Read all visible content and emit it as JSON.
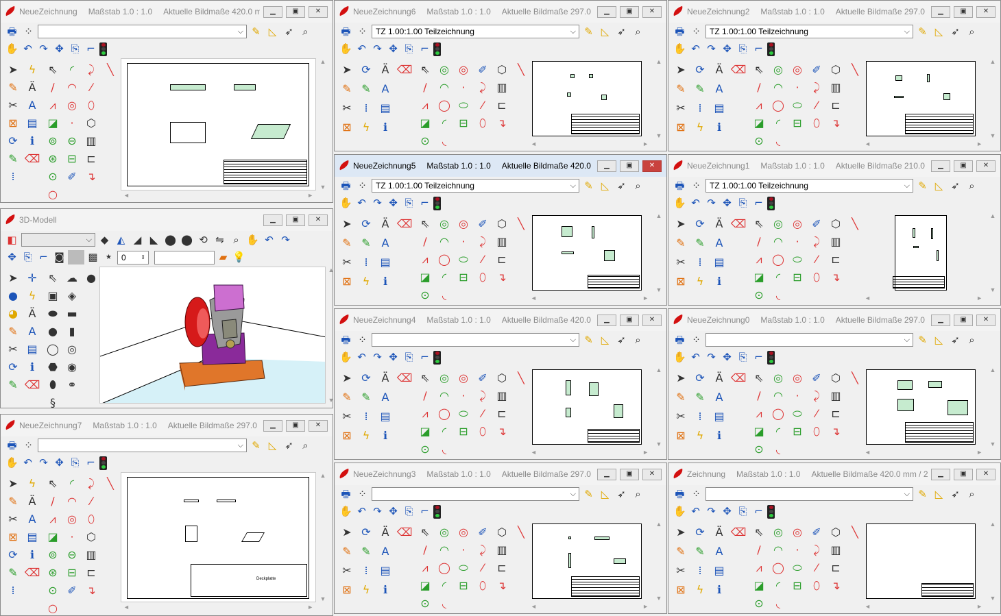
{
  "colors": {
    "accent": "#d31010",
    "part": "#2bb54a",
    "close_active": "#c9423e"
  },
  "icons": {
    "toolbar_left": [
      "print-icon",
      "layers-icon"
    ],
    "toolbar_right": [
      "lamp-icon",
      "set-square-icon",
      "pointer-icon",
      "zoom-window-icon"
    ],
    "nav": [
      "hand-pan-icon",
      "zoom-in-icon",
      "zoom-out-icon",
      "zoom-all-icon",
      "zoom-page-icon",
      "redraw-icon",
      "status-light-icon"
    ],
    "palette": [
      "arrow-select-icon",
      "lightning-icon",
      "rotate-icon",
      "text-edit-icon",
      "pencil-icon",
      "arrow-icon",
      "pen-icon",
      "text-style-icon",
      "snap-icon",
      "axis-icon",
      "hatch-icon",
      "cut-icon",
      "move-icon",
      "info-icon",
      "pen-green-icon",
      "eraser-icon",
      "line-icon",
      "arc-icon",
      "circle-icon",
      "ellipse-icon",
      "polyline-icon",
      "point-icon",
      "box-icon",
      "fillet-icon",
      "dimension-icon",
      "spline-icon"
    ]
  },
  "windows": {
    "w0": {
      "name": "NeueZeichnung",
      "scale": "Maßstab 1.0 : 1.0",
      "size": "Aktuelle Bildmaße 420.0 m...",
      "layer": ""
    },
    "w6": {
      "name": "NeueZeichnung6",
      "scale": "Maßstab 1.0 : 1.0",
      "size": "Aktuelle Bildmaße 297.0 ...",
      "layer": "TZ 1.00:1.00 Teilzeichnung"
    },
    "w2": {
      "name": "NeueZeichnung2",
      "scale": "Maßstab 1.0 : 1.0",
      "size": "Aktuelle Bildmaße 297.0 ...",
      "layer": "TZ 1.00:1.00 Teilzeichnung"
    },
    "w5": {
      "name": "NeueZeichnung5",
      "scale": "Maßstab 1.0 : 1.0",
      "size": "Aktuelle Bildmaße 420.0 ...",
      "layer": "TZ 1.00:1.00 Teilzeichnung"
    },
    "w1": {
      "name": "NeueZeichnung1",
      "scale": "Maßstab 1.0 : 1.0",
      "size": "Aktuelle Bildmaße 210.0 ...",
      "layer": "TZ 1.00:1.00 Teilzeichnung"
    },
    "w3d": {
      "name": "3D-Modell",
      "spin_value": "0"
    },
    "w4": {
      "name": "NeueZeichnung4",
      "scale": "Maßstab 1.0 : 1.0",
      "size": "Aktuelle Bildmaße 420.0 ...",
      "layer": ""
    },
    "w0b": {
      "name": "NeueZeichnung0",
      "scale": "Maßstab 1.0 : 1.0",
      "size": "Aktuelle Bildmaße 297.0 ...",
      "layer": ""
    },
    "w7": {
      "name": "NeueZeichnung7",
      "scale": "Maßstab 1.0 : 1.0",
      "size": "Aktuelle Bildmaße 297.0 ...",
      "layer": ""
    },
    "w3": {
      "name": "NeueZeichnung3",
      "scale": "Maßstab 1.0 : 1.0",
      "size": "Aktuelle Bildmaße 297.0 ...",
      "layer": ""
    },
    "wz": {
      "name": "Zeichnung",
      "scale": "Maßstab 1.0 : 1.0",
      "size": "Aktuelle Bildmaße 420.0 mm / 2...",
      "layer": ""
    }
  },
  "sheet_title": "Deckplatte",
  "active_window": "NeueZeichnung5"
}
